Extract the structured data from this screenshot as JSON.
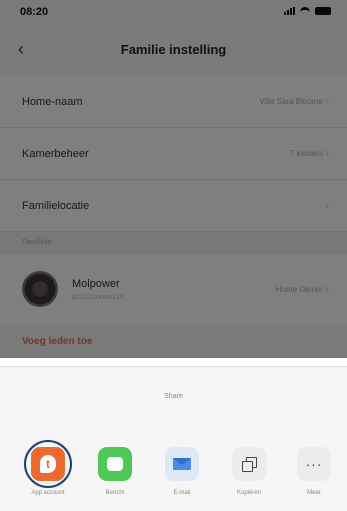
{
  "status_bar": {
    "time": "08:20"
  },
  "nav": {
    "title": "Familie instelling"
  },
  "rows": [
    {
      "label": "Home-naam",
      "value": "Villa Sara Bloome"
    },
    {
      "label": "Kamerbeheer",
      "value": "7 kamers"
    },
    {
      "label": "Familielocatie",
      "value": ""
    }
  ],
  "section": {
    "header": "Familielid"
  },
  "member": {
    "name": "Molpower",
    "sub": "a2102xxxxxxl.16",
    "role": "Home Owner"
  },
  "add_member_label": "Voeg leden toe",
  "share": {
    "title": "Share",
    "items": [
      {
        "label": "App account",
        "icon": "app-account-icon"
      },
      {
        "label": "Bericht",
        "icon": "message-icon"
      },
      {
        "label": "E-mail",
        "icon": "mail-icon"
      },
      {
        "label": "Kopiëren",
        "icon": "copy-icon"
      },
      {
        "label": "Meer",
        "icon": "more-icon"
      }
    ]
  },
  "colors": {
    "accent": "#ec6a2e",
    "highlight_ring": "#1c3f74",
    "add_member": "#e8734a"
  }
}
